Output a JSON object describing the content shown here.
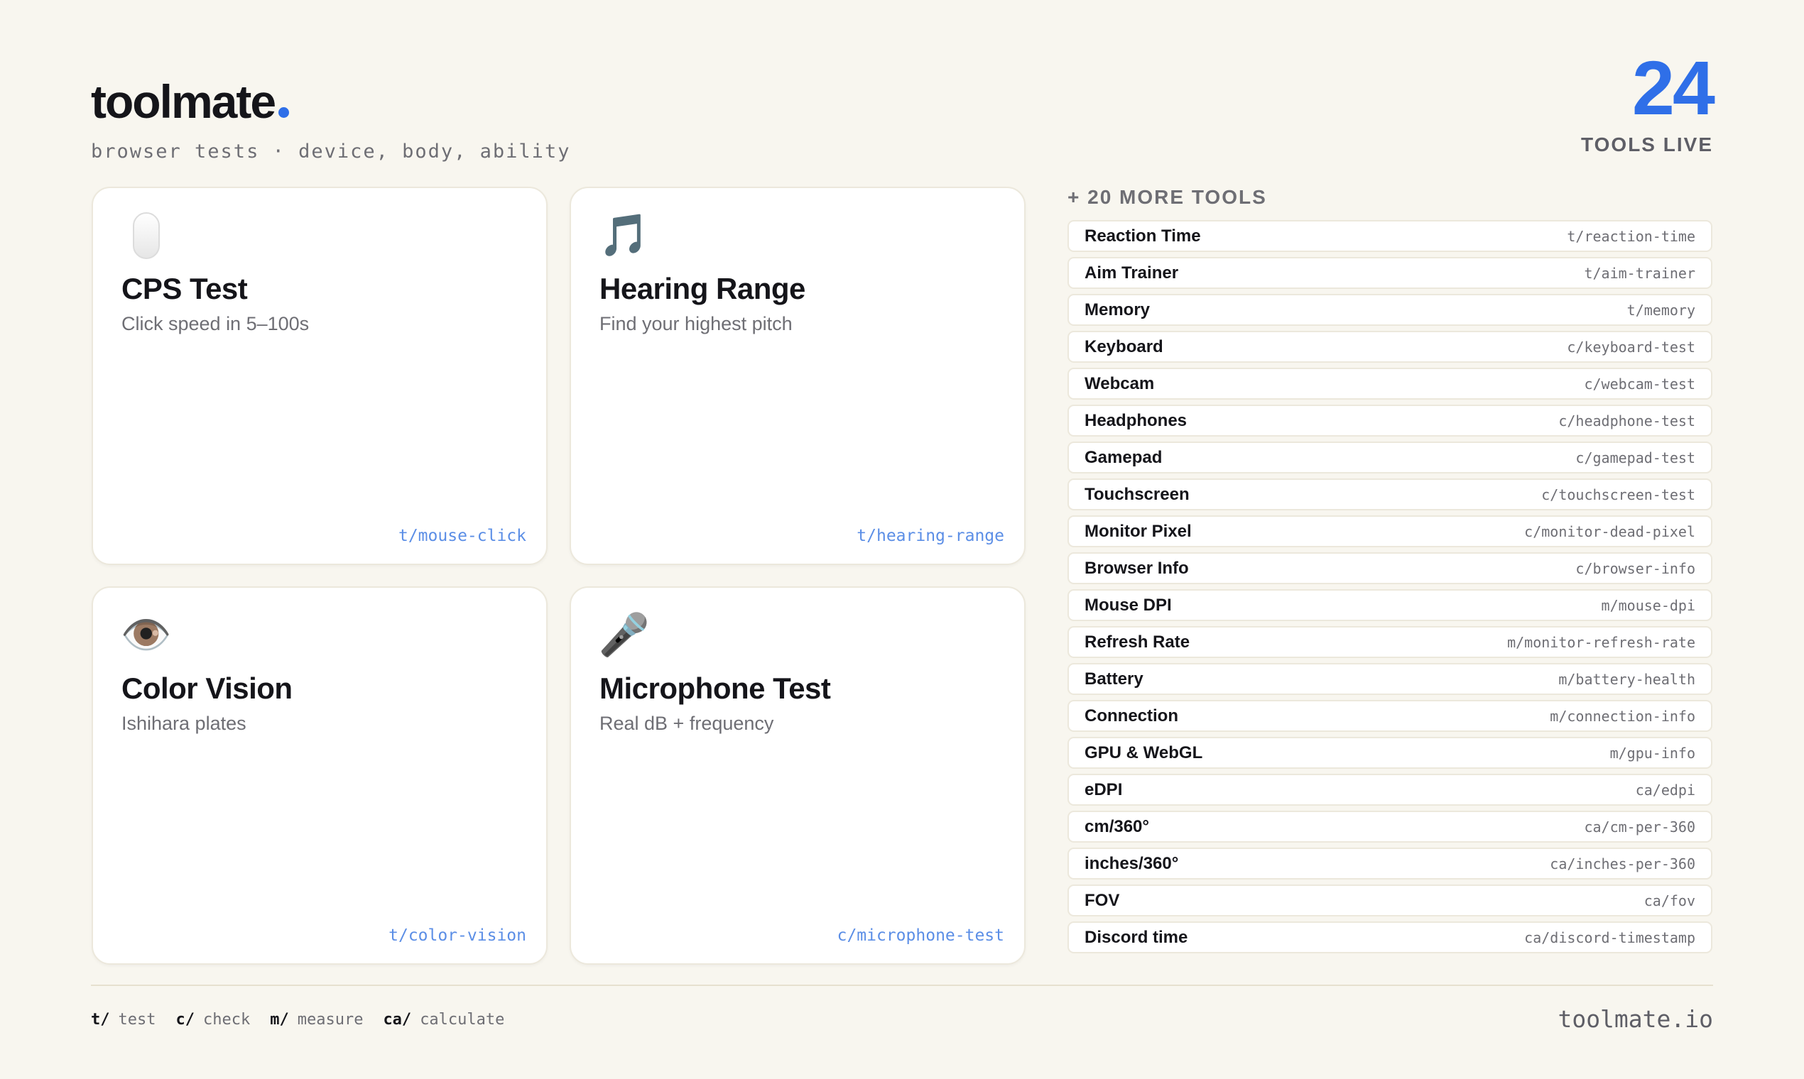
{
  "brand": {
    "logo": "toolmate",
    "tagline": "browser tests · device, body, ability"
  },
  "stats": {
    "count": "24",
    "label": "TOOLS LIVE"
  },
  "accent_color": "#2f6fe8",
  "featured": [
    {
      "icon": "mouse-icon",
      "title": "CPS Test",
      "subtitle": "Click speed in 5–100s",
      "slug": "t/mouse-click"
    },
    {
      "icon": "music-note-icon",
      "glyph": "🎵",
      "title": "Hearing Range",
      "subtitle": "Find your highest pitch",
      "slug": "t/hearing-range"
    },
    {
      "icon": "eye-icon",
      "glyph": "👁️",
      "title": "Color Vision",
      "subtitle": "Ishihara plates",
      "slug": "t/color-vision"
    },
    {
      "icon": "microphone-icon",
      "glyph": "🎤",
      "title": "Microphone Test",
      "subtitle": "Real dB + frequency",
      "slug": "c/microphone-test"
    }
  ],
  "more": {
    "title": "+ 20 MORE TOOLS",
    "tools": [
      {
        "name": "Reaction Time",
        "slug": "t/reaction-time"
      },
      {
        "name": "Aim Trainer",
        "slug": "t/aim-trainer"
      },
      {
        "name": "Memory",
        "slug": "t/memory"
      },
      {
        "name": "Keyboard",
        "slug": "c/keyboard-test"
      },
      {
        "name": "Webcam",
        "slug": "c/webcam-test"
      },
      {
        "name": "Headphones",
        "slug": "c/headphone-test"
      },
      {
        "name": "Gamepad",
        "slug": "c/gamepad-test"
      },
      {
        "name": "Touchscreen",
        "slug": "c/touchscreen-test"
      },
      {
        "name": "Monitor Pixel",
        "slug": "c/monitor-dead-pixel"
      },
      {
        "name": "Browser Info",
        "slug": "c/browser-info"
      },
      {
        "name": "Mouse DPI",
        "slug": "m/mouse-dpi"
      },
      {
        "name": "Refresh Rate",
        "slug": "m/monitor-refresh-rate"
      },
      {
        "name": "Battery",
        "slug": "m/battery-health"
      },
      {
        "name": "Connection",
        "slug": "m/connection-info"
      },
      {
        "name": "GPU & WebGL",
        "slug": "m/gpu-info"
      },
      {
        "name": "eDPI",
        "slug": "ca/edpi"
      },
      {
        "name": "cm/360°",
        "slug": "ca/cm-per-360"
      },
      {
        "name": "inches/360°",
        "slug": "ca/inches-per-360"
      },
      {
        "name": "FOV",
        "slug": "ca/fov"
      },
      {
        "name": "Discord time",
        "slug": "ca/discord-timestamp"
      }
    ]
  },
  "legend": [
    {
      "key": "t/",
      "label": "test"
    },
    {
      "key": "c/",
      "label": "check"
    },
    {
      "key": "m/",
      "label": "measure"
    },
    {
      "key": "ca/",
      "label": "calculate"
    }
  ],
  "footer": {
    "domain": "toolmate.io"
  }
}
